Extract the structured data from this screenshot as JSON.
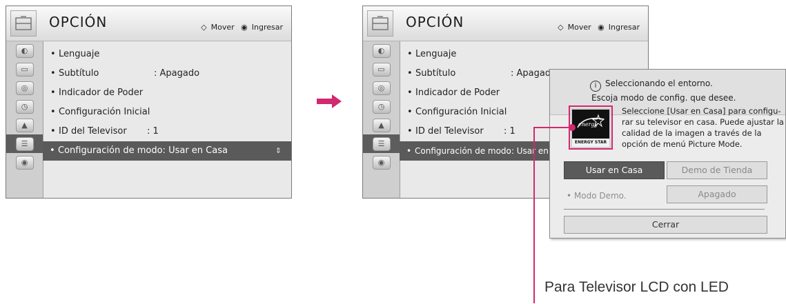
{
  "menu": {
    "title": "OPCIÓN",
    "hints": {
      "move": "Mover",
      "enter": "Ingresar"
    },
    "items": [
      {
        "label": "Lenguaje",
        "value": ""
      },
      {
        "label": "Subtítulo",
        "value": ": Apagado"
      },
      {
        "label": "Indicador de Poder",
        "value": ""
      },
      {
        "label": "Configuración Inicial",
        "value": ""
      },
      {
        "label": "ID del Televisor",
        "value": ": 1"
      },
      {
        "label": "Configuración de modo: Usar en Casa",
        "value": ""
      }
    ],
    "items_right_cut": [
      {
        "label": "Lenguaje",
        "value": ""
      },
      {
        "label": "Subtítulo",
        "value": ": Apagado"
      },
      {
        "label": "Indicador de Poder",
        "value": ""
      },
      {
        "label": "Configuración Inicial",
        "value": ""
      },
      {
        "label": "ID del Televisor",
        "value": ": 1"
      },
      {
        "label": "Configuración de modo: Usar en C",
        "value": ""
      }
    ],
    "selected_index": 5,
    "sidebar_icons": [
      "picture-icon",
      "monitor-icon",
      "speaker-icon",
      "clock-icon",
      "lock-icon",
      "option-icon",
      "network-icon"
    ],
    "active_sidebar_index": 5
  },
  "popup": {
    "msg1": "Seleccionando el entorno.",
    "msg2": "Escoja modo de config. que desee.",
    "description": [
      "Seleccione [Usar en Casa] para configu-",
      "rar su televisor en casa. Puede ajustar la",
      "calidad de la imagen a través de la",
      "opción de menú Picture Mode."
    ],
    "logo_text": "ENERGY STAR",
    "btn_home": "Usar en Casa",
    "btn_demo": "Demo de Tienda",
    "demo_mode_label": "• Modo Demo.",
    "demo_mode_value": "Apagado",
    "btn_close": "Cerrar"
  },
  "caption": "Para Televisor LCD con LED",
  "colors": {
    "accent": "#d1286f",
    "selected": "#5a5a5a",
    "panel": "#e9e9e9"
  }
}
